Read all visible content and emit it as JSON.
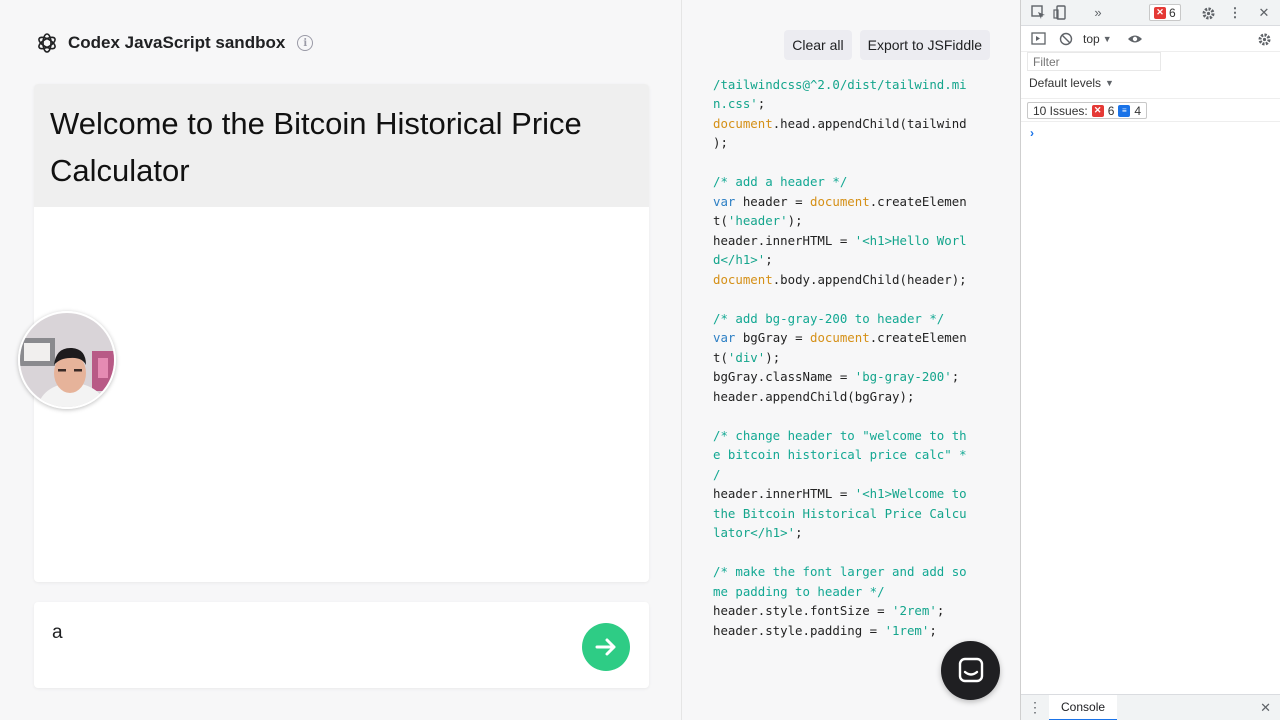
{
  "app": {
    "title": "Codex JavaScript sandbox",
    "info_icon": "i"
  },
  "preview": {
    "heading": "Welcome to the Bitcoin Historical Price Calculator"
  },
  "prompt": {
    "value": "a",
    "send_icon": "arrow-right-icon"
  },
  "code_pane": {
    "buttons": {
      "clear_all": "Clear all",
      "export": "Export to JSFiddle"
    }
  },
  "devtools": {
    "error_count": "6",
    "context": "top",
    "filter_placeholder": "Filter",
    "levels": "Default levels",
    "issues_label": "10 Issues:",
    "issues_errors": "6",
    "issues_info": "4",
    "prompt_symbol": "›",
    "drawer_tab": "Console"
  },
  "colors": {
    "send_button": "#2ecc85",
    "code_comment": "#13a893",
    "code_keyword": "#2c7fc4",
    "code_object": "#d59017"
  }
}
